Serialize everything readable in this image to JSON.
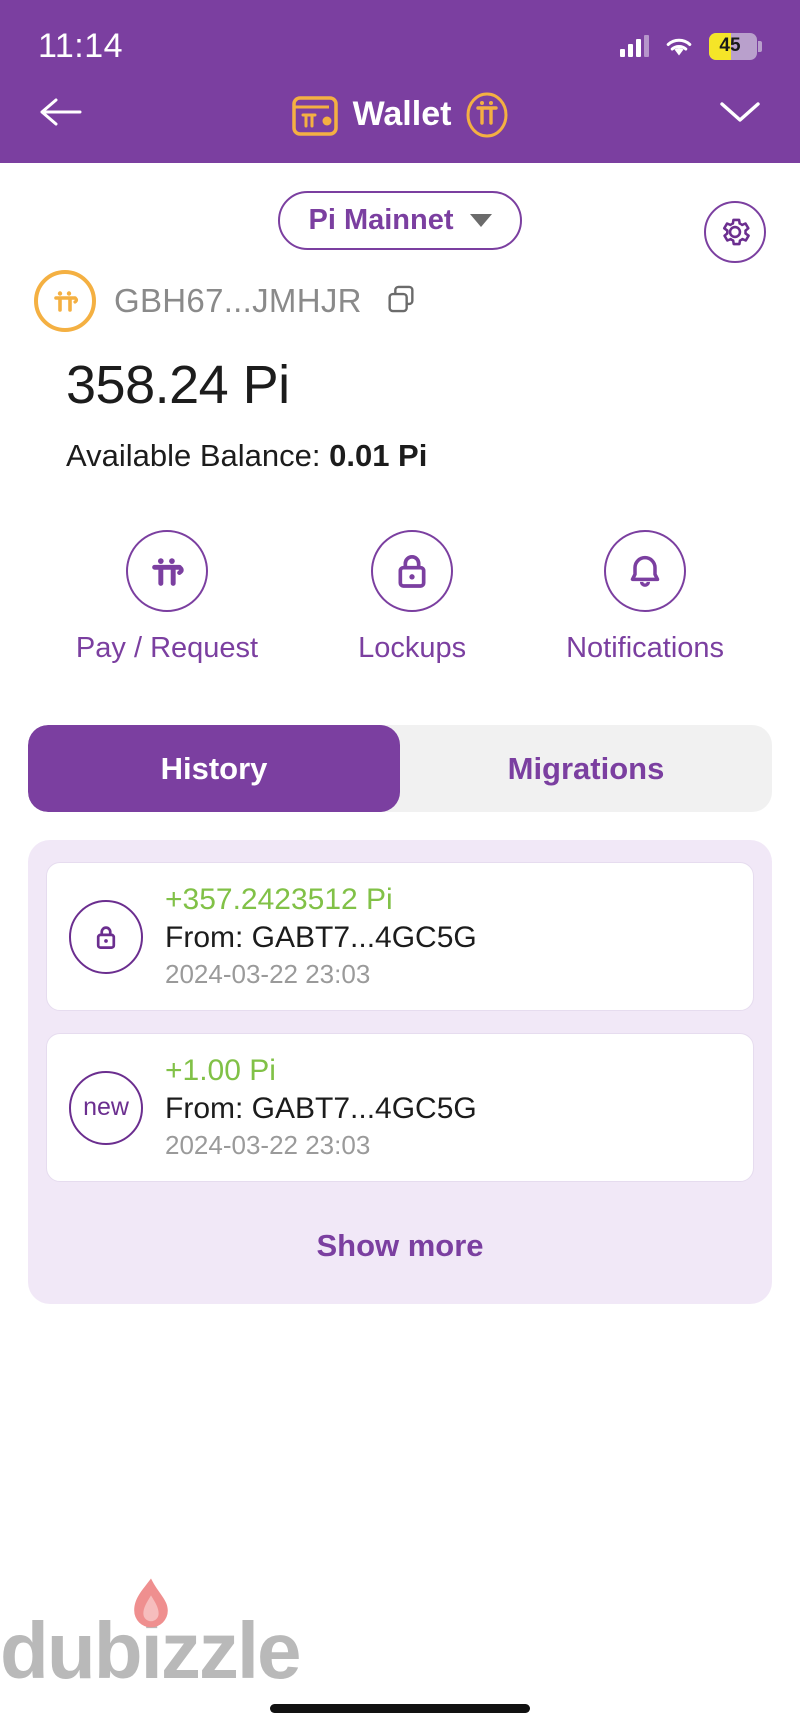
{
  "status_bar": {
    "time": "11:14",
    "battery_percent": "45",
    "signal_icon": "signal-bars-icon",
    "wifi_icon": "wifi-icon"
  },
  "nav": {
    "back_icon": "back-arrow-icon",
    "wallet_icon": "wallet-icon",
    "title": "Wallet",
    "pi_icon": "pi-logo-icon",
    "chevron_icon": "chevron-down-icon"
  },
  "network": {
    "name": "Pi Mainnet",
    "caret_icon": "caret-down-icon",
    "settings_icon": "gear-icon"
  },
  "account": {
    "coin_icon": "pi-coin-icon",
    "address": "GBH67...JMHJR",
    "copy_icon": "copy-icon",
    "balance": "358.24 Pi",
    "available_label": "Available Balance: ",
    "available_value": "0.01 Pi"
  },
  "actions": [
    {
      "label": "Pay / Request",
      "icon": "pi-symbol-icon"
    },
    {
      "label": "Lockups",
      "icon": "lock-icon"
    },
    {
      "label": "Notifications",
      "icon": "bell-icon"
    }
  ],
  "tabs": [
    {
      "label": "History",
      "active": true
    },
    {
      "label": "Migrations",
      "active": false
    }
  ],
  "transactions": [
    {
      "badge": "lock-icon",
      "badge_text": "",
      "amount": "+357.2423512 Pi",
      "from": "From: GABT7...4GC5G",
      "date": "2024-03-22 23:03"
    },
    {
      "badge": "new-badge",
      "badge_text": "new",
      "amount": "+1.00 Pi",
      "from": "From: GABT7...4GC5G",
      "date": "2024-03-22 23:03"
    }
  ],
  "show_more_label": "Show more",
  "watermark": "dubizzle",
  "colors": {
    "purple": "#7b3fa0",
    "deep_purple": "#6b2e8f",
    "orange": "#f4b042",
    "green": "#81c147",
    "panel": "#f1e8f7"
  }
}
